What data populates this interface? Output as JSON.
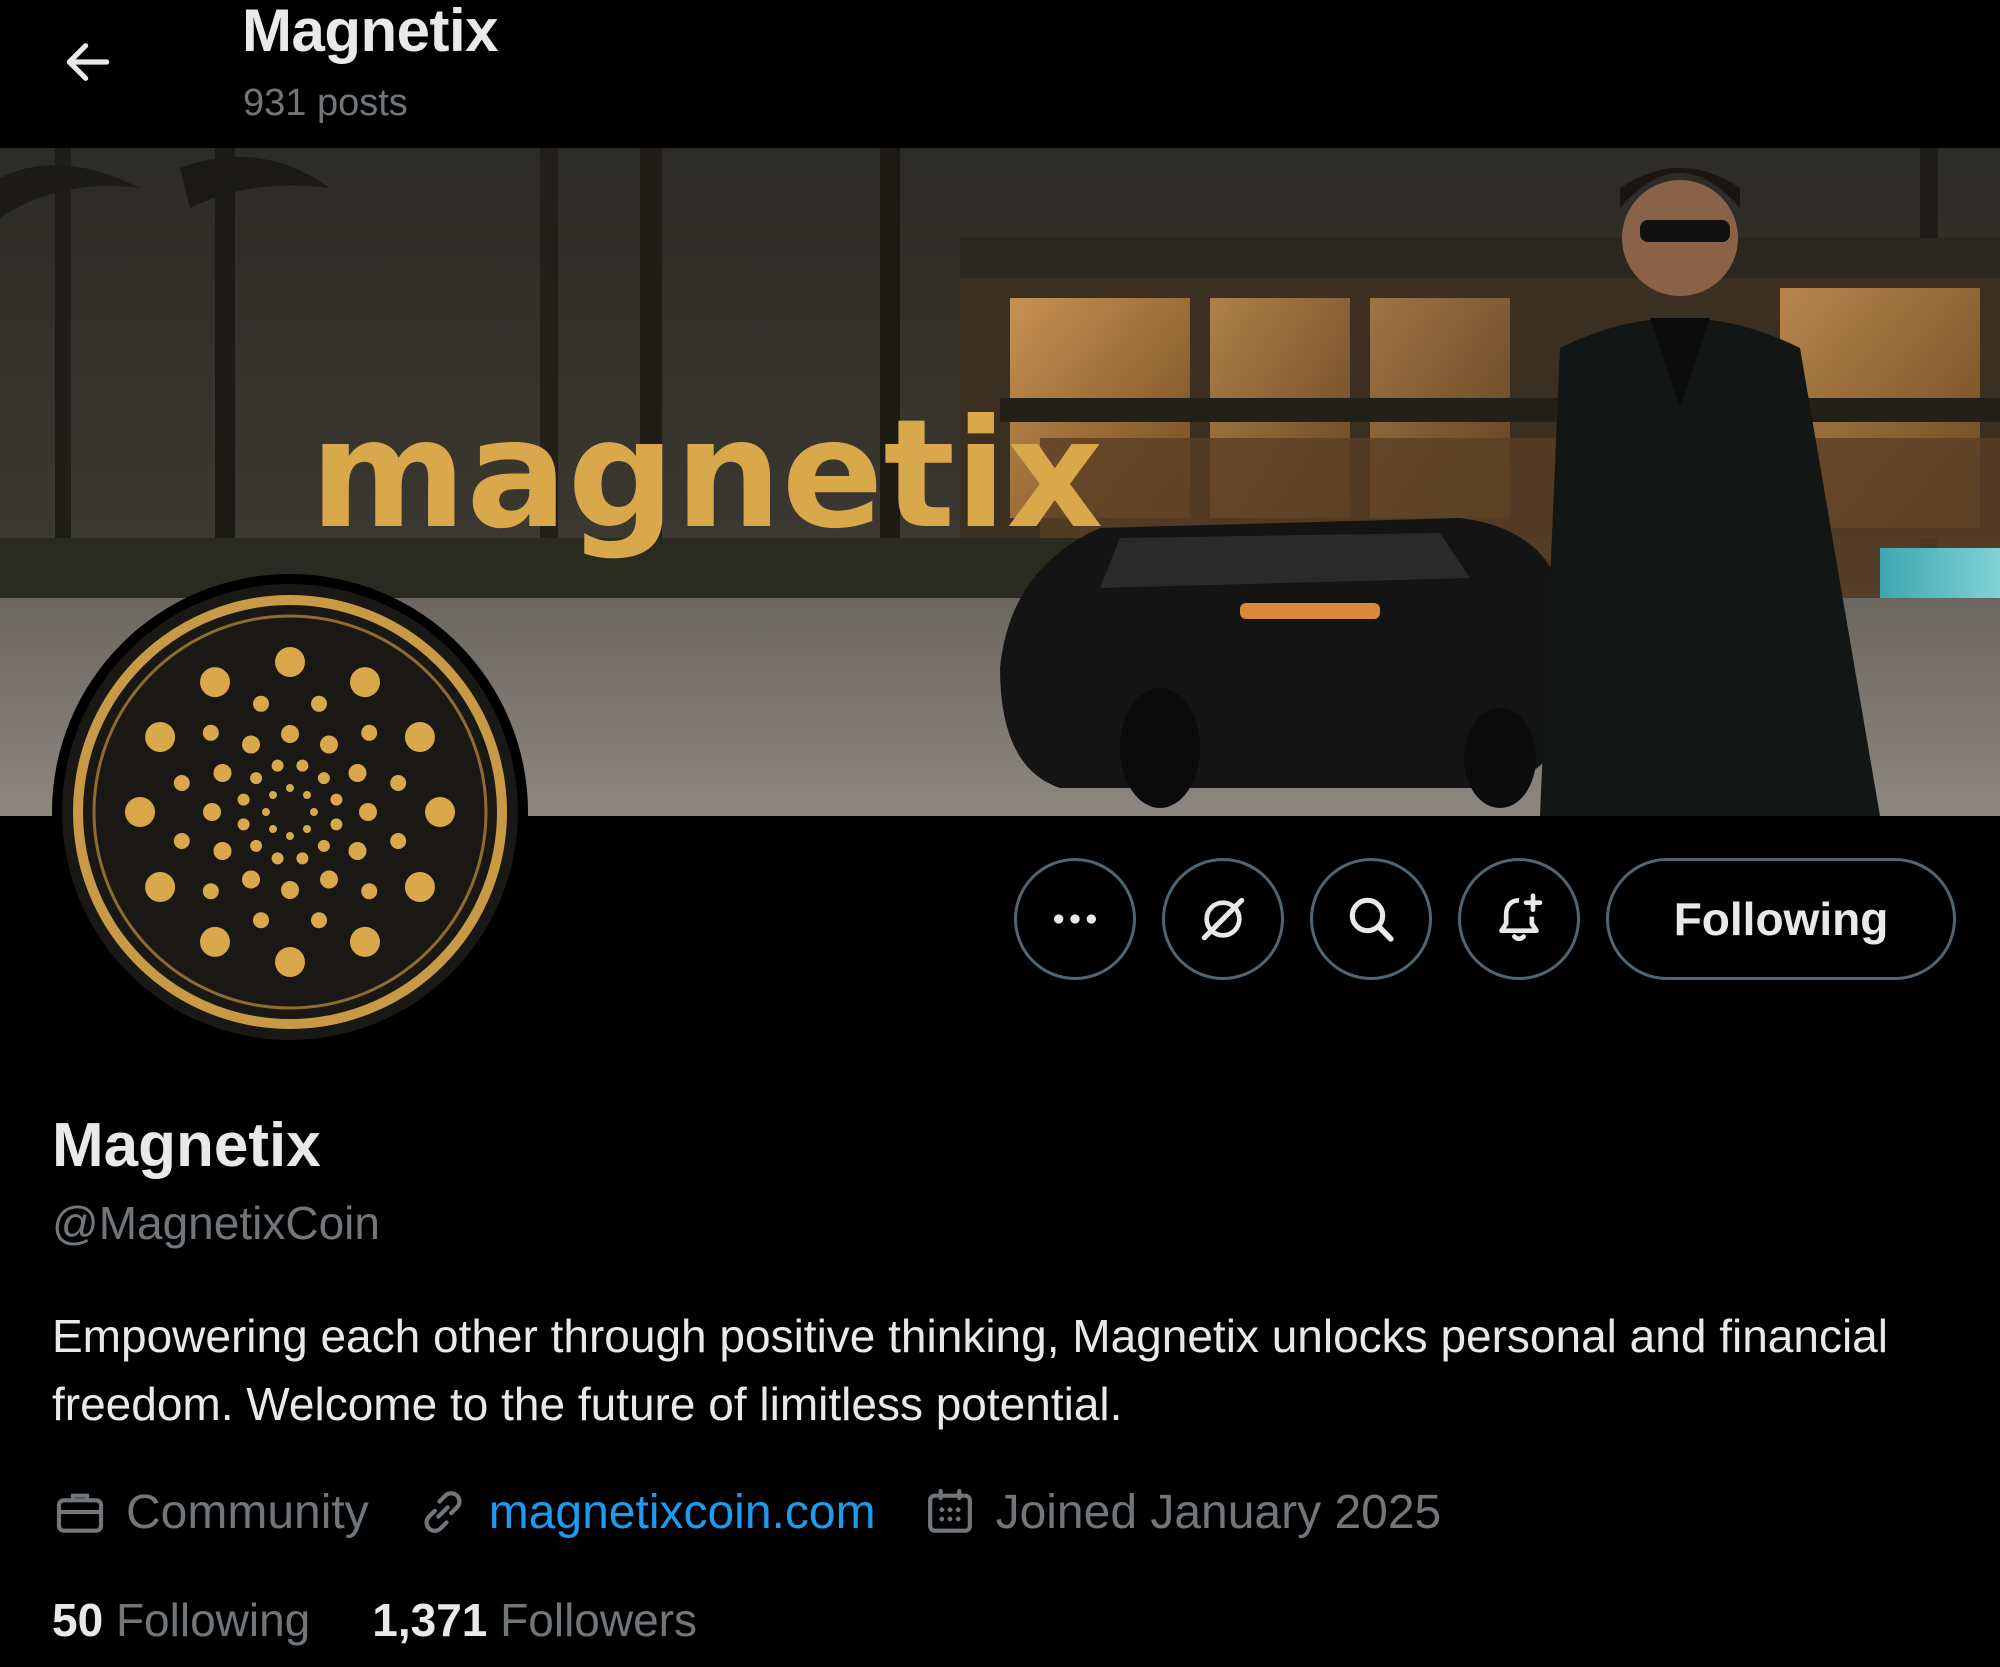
{
  "header": {
    "title": "Magnetix",
    "post_count": "931 posts"
  },
  "banner": {
    "wordmark": "magnetix"
  },
  "actions": {
    "following_label": "Following"
  },
  "profile": {
    "display_name": "Magnetix",
    "handle": "@MagnetixCoin",
    "bio": "Empowering each other through positive thinking, Magnetix unlocks personal and financial freedom. Welcome to the future of limitless potential.",
    "category": "Community",
    "website": "magnetixcoin.com",
    "joined": "Joined January 2025"
  },
  "stats": {
    "following_count": "50",
    "following_label": "Following",
    "followers_count": "1,371",
    "followers_label": "Followers"
  },
  "icons": {
    "back": "arrow-left-icon",
    "more": "more-dots-icon",
    "grok": "grok-icon",
    "search": "search-icon",
    "notify": "bell-plus-icon",
    "category": "briefcase-icon",
    "link": "link-icon",
    "joined": "calendar-icon"
  },
  "colors": {
    "background": "#000000",
    "primary_text": "#e7e9ea",
    "secondary_text": "#71767b",
    "link": "#1d9bf0",
    "button_border": "#536471",
    "brand_gold": "#d9a84a"
  }
}
